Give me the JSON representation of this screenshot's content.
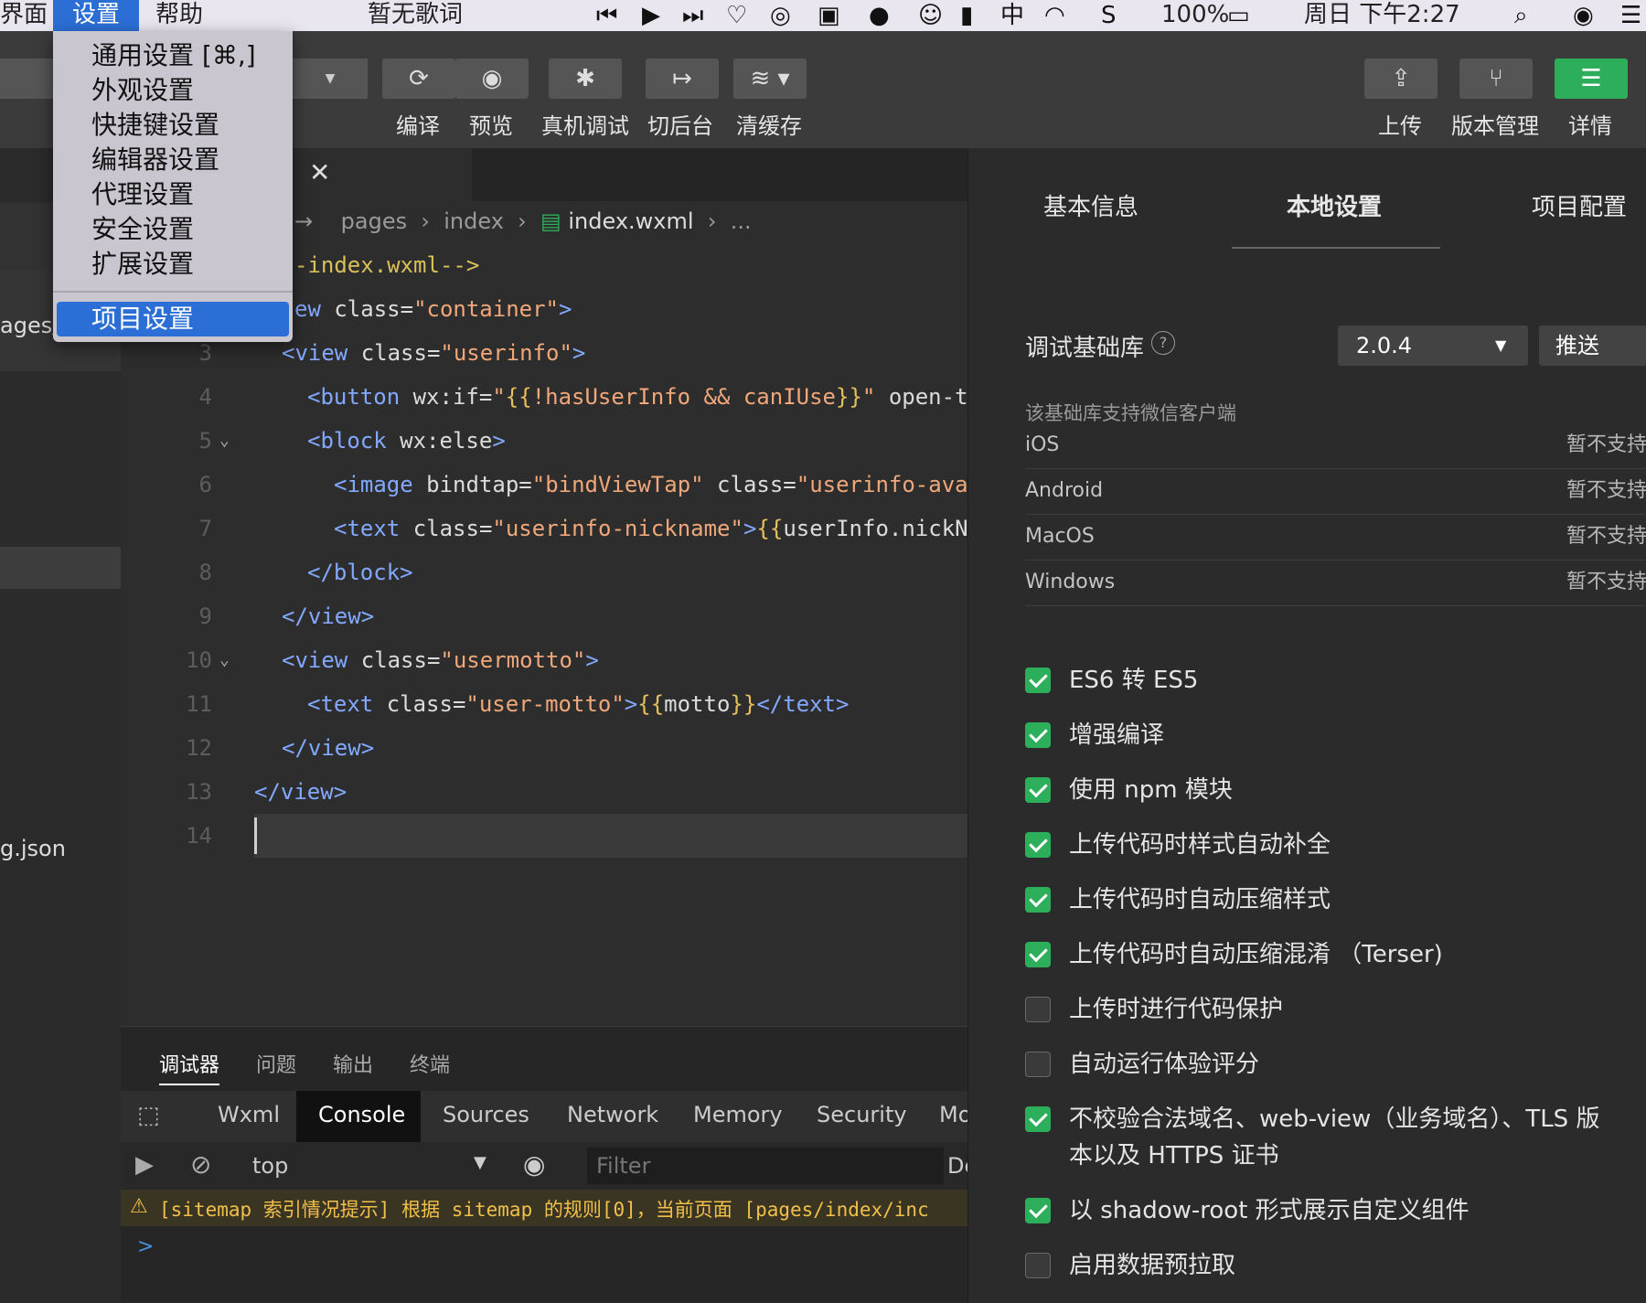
{
  "menubar": {
    "left_partial": "界面",
    "settings": "设置",
    "help": "帮助",
    "now_playing": "暂无歌词",
    "battery": "100%",
    "clock": "周日 下午2:27"
  },
  "settings_menu": {
    "items": [
      "通用设置 [⌘,]",
      "外观设置",
      "快捷键设置",
      "编辑器设置",
      "代理设置",
      "安全设置",
      "扩展设置"
    ],
    "selected": "项目设置"
  },
  "toolbar": {
    "compile": "编译",
    "preview": "预览",
    "remote_debug": "真机调试",
    "background": "切后台",
    "clear_cache": "清缓存",
    "upload": "上传",
    "version": "版本管理",
    "details": "详情"
  },
  "sidebar": {
    "path_fragment": "ages/",
    "json_fragment": "g.json"
  },
  "editor": {
    "breadcrumb": [
      "pages",
      "index",
      "index.wxml",
      "..."
    ],
    "line_numbers": [
      "3",
      "4",
      "5",
      "6",
      "7",
      "8",
      "9",
      "10",
      "11",
      "12",
      "13",
      "14"
    ]
  },
  "console": {
    "top_tabs": [
      "调试器",
      "问题",
      "输出",
      "终端"
    ],
    "dev_tabs": [
      "Wxml",
      "Console",
      "Sources",
      "Network",
      "Memory",
      "Security",
      "Mo"
    ],
    "context": "top",
    "filter_placeholder": "Filter",
    "levels_partial": "De",
    "warning": "[sitemap 索引情况提示] 根据 sitemap 的规则[0]，当前页面 [pages/index/inc",
    "prompt": ">"
  },
  "right_panel": {
    "tabs": [
      "基本信息",
      "本地设置",
      "项目配置"
    ],
    "lib_label": "调试基础库",
    "lib_version": "2.0.4",
    "push_button": "推送",
    "support_heading": "该基础库支持微信客户端",
    "platforms": [
      {
        "name": "iOS",
        "status": "暂不支持"
      },
      {
        "name": "Android",
        "status": "暂不支持"
      },
      {
        "name": "MacOS",
        "status": "暂不支持"
      },
      {
        "name": "Windows",
        "status": "暂不支持"
      }
    ],
    "options": [
      {
        "label": "ES6 转 ES5",
        "checked": true
      },
      {
        "label": "增强编译",
        "checked": true
      },
      {
        "label": "使用 npm 模块",
        "checked": true
      },
      {
        "label": "上传代码时样式自动补全",
        "checked": true
      },
      {
        "label": "上传代码时自动压缩样式",
        "checked": true
      },
      {
        "label": "上传代码时自动压缩混淆 （Terser)",
        "checked": true
      },
      {
        "label": "上传时进行代码保护",
        "checked": false
      },
      {
        "label": "自动运行体验评分",
        "checked": false
      },
      {
        "label": "不校验合法域名、web-view（业务域名）、TLS 版本以及 HTTPS 证书",
        "checked": true
      },
      {
        "label": "以 shadow-root 形式展示自定义组件",
        "checked": true
      },
      {
        "label": "启用数据预拉取",
        "checked": false
      }
    ]
  },
  "colors": {
    "accent_blue": "#2b6fd6",
    "green": "#2dae5a",
    "tag": "#82a9ff",
    "string": "#f0a77a"
  }
}
